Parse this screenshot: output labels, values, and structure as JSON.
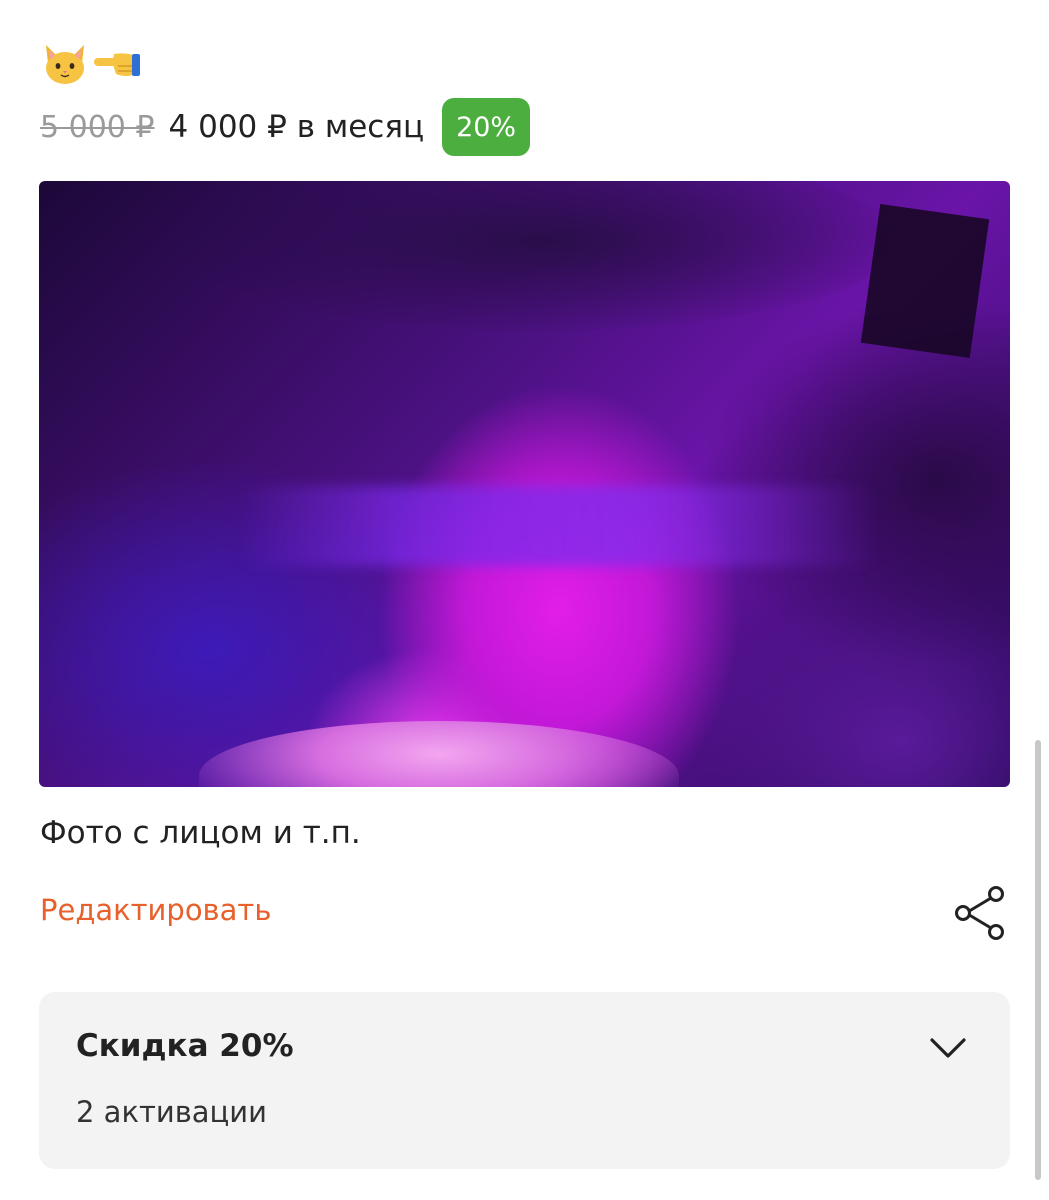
{
  "header": {
    "emoji_icons": [
      "cat-face-icon",
      "pointing-left-hand-icon"
    ]
  },
  "price": {
    "old": "5 000 ₽",
    "current": "4 000 ₽ в месяц",
    "discount_badge": "20%"
  },
  "photo": {
    "content": "blurred-face-photo"
  },
  "description": "Фото с лицом и т.п.",
  "actions": {
    "edit_label": "Редактировать",
    "share_icon": "share-icon"
  },
  "discount": {
    "title": "Скидка 20%",
    "activations": "2 активации",
    "expand_icon": "chevron-down-icon"
  },
  "colors": {
    "accent": "#e8602c",
    "badge": "#4cae3f"
  }
}
